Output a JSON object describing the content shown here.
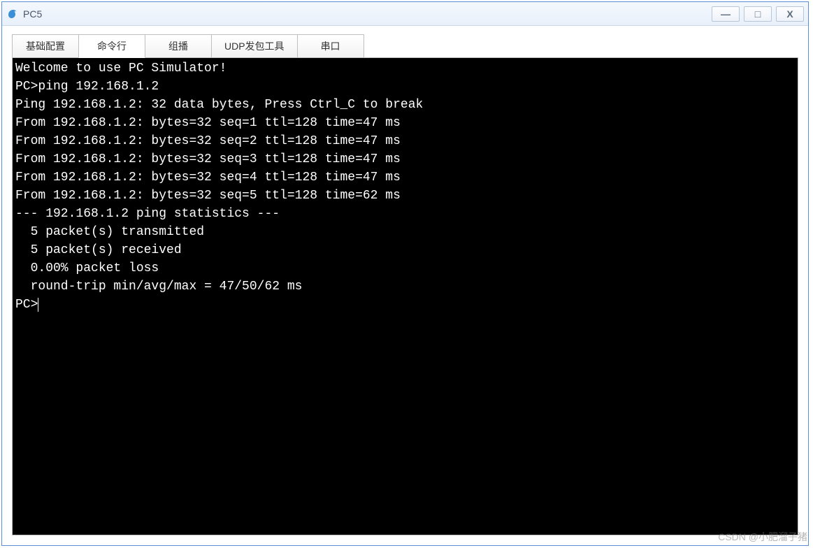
{
  "window": {
    "title": "PC5"
  },
  "titlebar_buttons": {
    "minimize": "—",
    "maximize": "□",
    "close": "X"
  },
  "tabs": [
    {
      "label": "基础配置",
      "active": false
    },
    {
      "label": "命令行",
      "active": true
    },
    {
      "label": "组播",
      "active": false
    },
    {
      "label": "UDP发包工具",
      "active": false
    },
    {
      "label": "串口",
      "active": false
    }
  ],
  "terminal": {
    "welcome": "Welcome to use PC Simulator!",
    "blank": "",
    "prompt_cmd": "PC>ping 192.168.1.2",
    "ping_header": "Ping 192.168.1.2: 32 data bytes, Press Ctrl_C to break",
    "replies": [
      "From 192.168.1.2: bytes=32 seq=1 ttl=128 time=47 ms",
      "From 192.168.1.2: bytes=32 seq=2 ttl=128 time=47 ms",
      "From 192.168.1.2: bytes=32 seq=3 ttl=128 time=47 ms",
      "From 192.168.1.2: bytes=32 seq=4 ttl=128 time=47 ms",
      "From 192.168.1.2: bytes=32 seq=5 ttl=128 time=62 ms"
    ],
    "stats_header": "--- 192.168.1.2 ping statistics ---",
    "stats_tx": "  5 packet(s) transmitted",
    "stats_rx": "  5 packet(s) received",
    "stats_loss": "  0.00% packet loss",
    "stats_rtt": "  round-trip min/avg/max = 47/50/62 ms",
    "prompt": "PC>"
  },
  "watermark": "CSDN @小肥溜子猪"
}
